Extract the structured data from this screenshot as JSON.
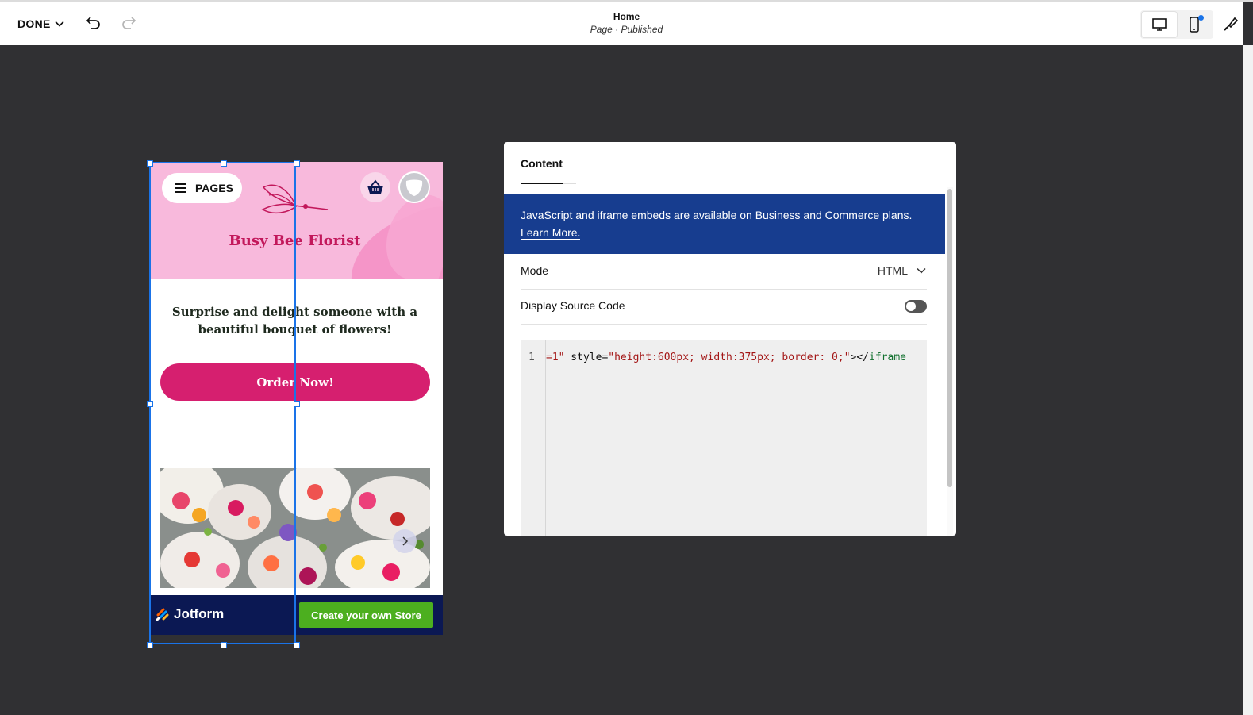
{
  "topbar": {
    "done_label": "DONE",
    "page_title": "Home",
    "page_status": "Page · Published"
  },
  "preview": {
    "pages_label": "PAGES",
    "brand_name": "Busy Bee Florist",
    "tagline": "Surprise and delight someone with a beautiful bouquet of flowers!",
    "order_button": "Order Now!",
    "jotform_logo": "Jotform",
    "store_button": "Create your own Store"
  },
  "panel": {
    "tab_label": "Content",
    "banner_text": "JavaScript and iframe embeds are available on Business and Commerce plans.",
    "banner_link": "Learn More.",
    "mode_label": "Mode",
    "mode_value": "HTML",
    "display_source_label": "Display Source Code",
    "display_source_on": false,
    "code": {
      "line_number": "1",
      "segments": [
        "=1\"",
        " style=",
        "\"height:600px; width:375px; border: 0;\"",
        "></",
        "iframe"
      ]
    }
  },
  "colors": {
    "accent": "#1a73e8",
    "banner": "#173d8f",
    "order_button": "#d61f6f",
    "brand_text": "#c2185b",
    "jotform_bar": "#0b1853",
    "store_button": "#4caf1f"
  }
}
